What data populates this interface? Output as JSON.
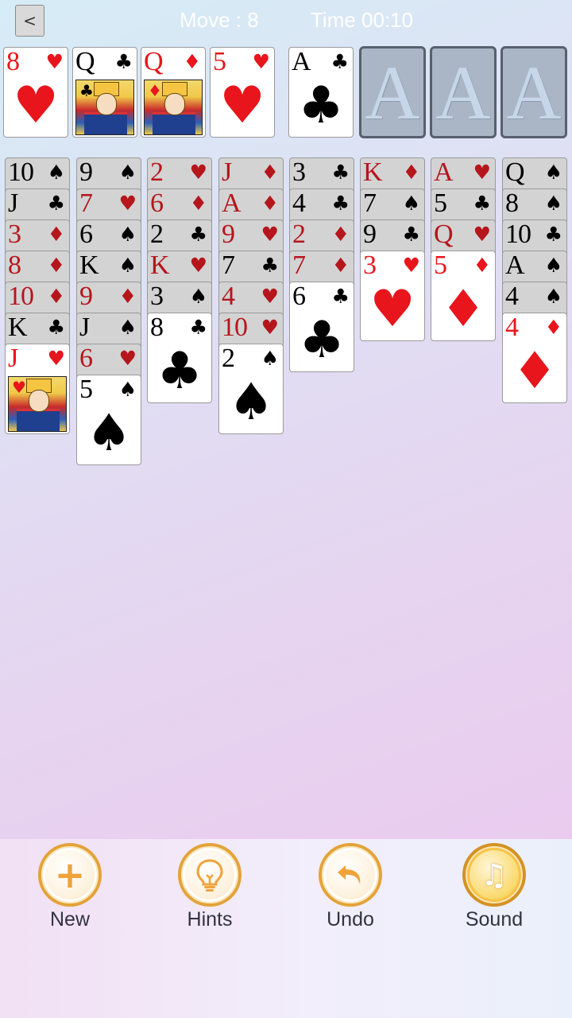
{
  "header": {
    "back_label": "<",
    "move_text": "Move : 8",
    "time_text": "Time 00:10"
  },
  "freecells": [
    {
      "rank": "8",
      "suit": "♥",
      "color": "red",
      "face": false
    },
    {
      "rank": "Q",
      "suit": "♣",
      "color": "black",
      "face": true
    },
    {
      "rank": "Q",
      "suit": "♦",
      "color": "red",
      "face": true
    },
    {
      "rank": "5",
      "suit": "♥",
      "color": "red",
      "face": false
    }
  ],
  "foundations": [
    {
      "type": "card",
      "rank": "A",
      "suit": "♣",
      "color": "black"
    },
    {
      "type": "empty",
      "label": "A"
    },
    {
      "type": "empty",
      "label": "A"
    },
    {
      "type": "empty",
      "label": "A"
    }
  ],
  "tableau": [
    [
      {
        "rank": "10",
        "suit": "♠",
        "color": "black"
      },
      {
        "rank": "J",
        "suit": "♣",
        "color": "black"
      },
      {
        "rank": "3",
        "suit": "♦",
        "color": "red"
      },
      {
        "rank": "8",
        "suit": "♦",
        "color": "red"
      },
      {
        "rank": "10",
        "suit": "♦",
        "color": "red"
      },
      {
        "rank": "K",
        "suit": "♣",
        "color": "black"
      },
      {
        "rank": "J",
        "suit": "♥",
        "color": "red",
        "face": true
      }
    ],
    [
      {
        "rank": "9",
        "suit": "♠",
        "color": "black"
      },
      {
        "rank": "7",
        "suit": "♥",
        "color": "red"
      },
      {
        "rank": "6",
        "suit": "♠",
        "color": "black"
      },
      {
        "rank": "K",
        "suit": "♠",
        "color": "black"
      },
      {
        "rank": "9",
        "suit": "♦",
        "color": "red"
      },
      {
        "rank": "J",
        "suit": "♠",
        "color": "black"
      },
      {
        "rank": "6",
        "suit": "♥",
        "color": "red"
      },
      {
        "rank": "5",
        "suit": "♠",
        "color": "black"
      }
    ],
    [
      {
        "rank": "2",
        "suit": "♥",
        "color": "red"
      },
      {
        "rank": "6",
        "suit": "♦",
        "color": "red"
      },
      {
        "rank": "2",
        "suit": "♣",
        "color": "black"
      },
      {
        "rank": "K",
        "suit": "♥",
        "color": "red"
      },
      {
        "rank": "3",
        "suit": "♠",
        "color": "black"
      },
      {
        "rank": "8",
        "suit": "♣",
        "color": "black"
      }
    ],
    [
      {
        "rank": "J",
        "suit": "♦",
        "color": "red"
      },
      {
        "rank": "A",
        "suit": "♦",
        "color": "red"
      },
      {
        "rank": "9",
        "suit": "♥",
        "color": "red"
      },
      {
        "rank": "7",
        "suit": "♣",
        "color": "black"
      },
      {
        "rank": "4",
        "suit": "♥",
        "color": "red"
      },
      {
        "rank": "10",
        "suit": "♥",
        "color": "red"
      },
      {
        "rank": "2",
        "suit": "♠",
        "color": "black"
      }
    ],
    [
      {
        "rank": "3",
        "suit": "♣",
        "color": "black"
      },
      {
        "rank": "4",
        "suit": "♣",
        "color": "black"
      },
      {
        "rank": "2",
        "suit": "♦",
        "color": "red"
      },
      {
        "rank": "7",
        "suit": "♦",
        "color": "red"
      },
      {
        "rank": "6",
        "suit": "♣",
        "color": "black"
      }
    ],
    [
      {
        "rank": "K",
        "suit": "♦",
        "color": "red"
      },
      {
        "rank": "7",
        "suit": "♠",
        "color": "black"
      },
      {
        "rank": "9",
        "suit": "♣",
        "color": "black"
      },
      {
        "rank": "3",
        "suit": "♥",
        "color": "red"
      }
    ],
    [
      {
        "rank": "A",
        "suit": "♥",
        "color": "red"
      },
      {
        "rank": "5",
        "suit": "♣",
        "color": "black"
      },
      {
        "rank": "Q",
        "suit": "♥",
        "color": "red"
      },
      {
        "rank": "5",
        "suit": "♦",
        "color": "red"
      }
    ],
    [
      {
        "rank": "Q",
        "suit": "♠",
        "color": "black"
      },
      {
        "rank": "8",
        "suit": "♠",
        "color": "black"
      },
      {
        "rank": "10",
        "suit": "♣",
        "color": "black"
      },
      {
        "rank": "A",
        "suit": "♠",
        "color": "black"
      },
      {
        "rank": "4",
        "suit": "♠",
        "color": "black"
      },
      {
        "rank": "4",
        "suit": "♦",
        "color": "red"
      }
    ]
  ],
  "toolbar": {
    "new_label": "New",
    "new_icon": "plus-icon",
    "hints_label": "Hints",
    "hints_icon": "lightbulb-icon",
    "undo_label": "Undo",
    "undo_icon": "undo-arrow-icon",
    "sound_label": "Sound",
    "sound_icon": "music-note-icon"
  },
  "colors": {
    "red_suit": "#e8151c",
    "black_suit": "#000000",
    "accent_gold": "#e3a339"
  }
}
